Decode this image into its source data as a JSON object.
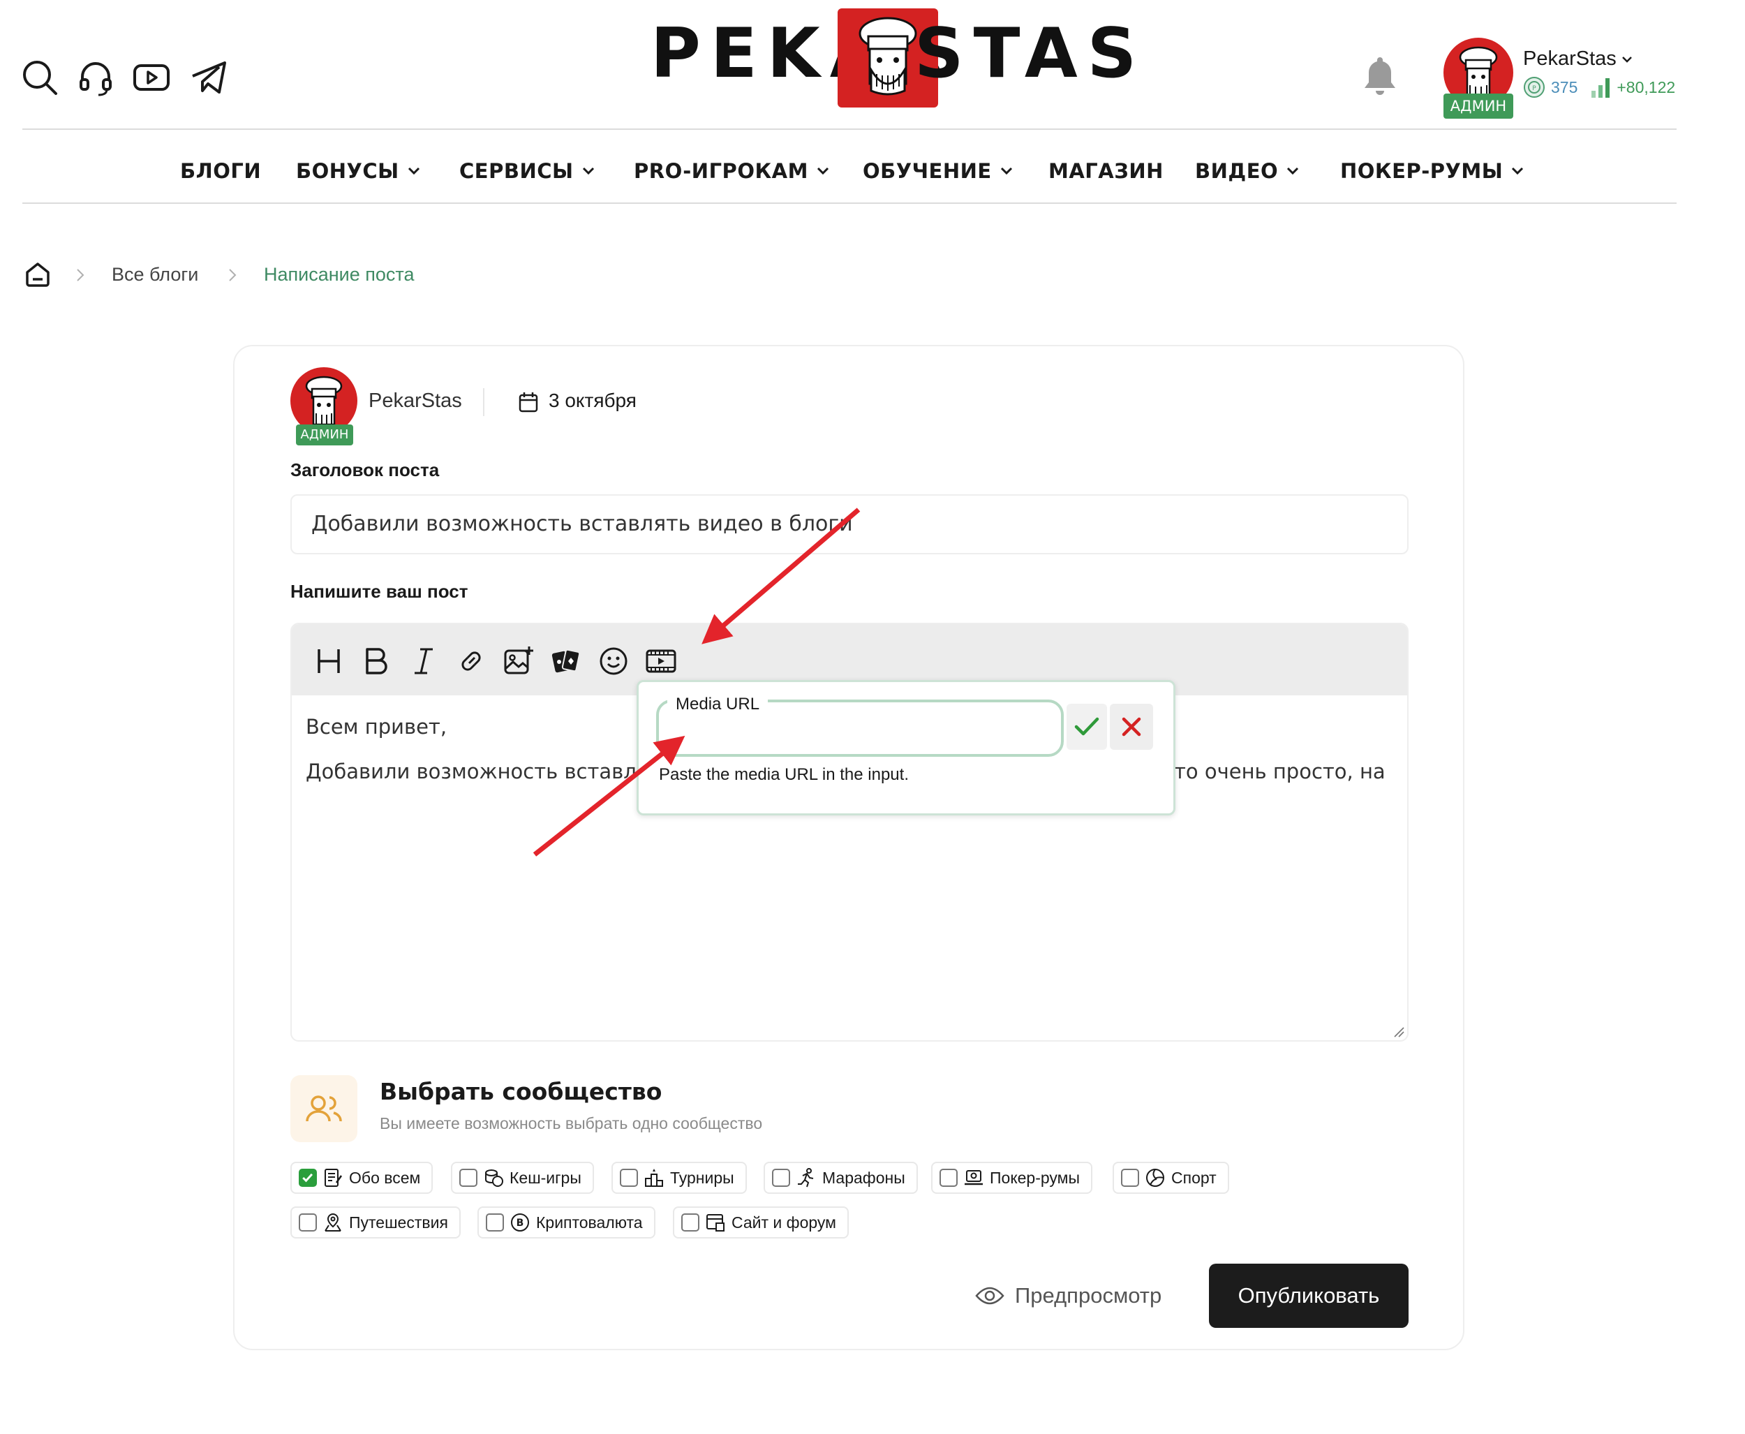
{
  "header": {
    "logo_left": "PEKAR",
    "logo_right": "STAS",
    "icons": [
      "search-icon",
      "headset-icon",
      "youtube-icon",
      "telegram-icon"
    ],
    "user": {
      "name": "PekarStas",
      "role_badge": "АДМИН",
      "points": "375",
      "rating": "+80,122"
    }
  },
  "nav": {
    "items": [
      {
        "label": "БЛОГИ",
        "dropdown": false
      },
      {
        "label": "БОНУСЫ",
        "dropdown": true
      },
      {
        "label": "СЕРВИСЫ",
        "dropdown": true
      },
      {
        "label": "PRO-ИГРОКАМ",
        "dropdown": true
      },
      {
        "label": "ОБУЧЕНИЕ",
        "dropdown": true
      },
      {
        "label": "МАГАЗИН",
        "dropdown": false
      },
      {
        "label": "ВИДЕО",
        "dropdown": true
      },
      {
        "label": "ПОКЕР-РУМЫ",
        "dropdown": true
      }
    ]
  },
  "breadcrumb": {
    "items": [
      "Все блоги",
      "Написание поста"
    ]
  },
  "post": {
    "author": "PekarStas",
    "author_badge": "АДМИН",
    "date": "3 октября",
    "title_label": "Заголовок поста",
    "title_value": "Добавили возможность вставлять видео в блоги",
    "body_label": "Напишите ваш пост",
    "toolbar": [
      "heading-icon",
      "bold-icon",
      "italic-icon",
      "link-icon",
      "image-icon",
      "cards-icon",
      "emoji-icon",
      "video-icon"
    ],
    "body_line1": "Всем привет,",
    "body_line2_start": "Добавили возможность вставля",
    "body_line2_end": "то очень просто, на"
  },
  "media_popup": {
    "legend": "Media URL",
    "value": "",
    "hint": "Paste the media URL in the input."
  },
  "community": {
    "title": "Выбрать сообщество",
    "subtitle": "Вы имеете возможность выбрать одно сообщество",
    "options": [
      {
        "label": "Обо всем",
        "checked": true,
        "icon": "notes-icon"
      },
      {
        "label": "Кеш-игры",
        "checked": false,
        "icon": "coins-icon"
      },
      {
        "label": "Турниры",
        "checked": false,
        "icon": "podium-icon"
      },
      {
        "label": "Марафоны",
        "checked": false,
        "icon": "runner-icon"
      },
      {
        "label": "Покер-румы",
        "checked": false,
        "icon": "laptop-icon"
      },
      {
        "label": "Спорт",
        "checked": false,
        "icon": "volleyball-icon"
      },
      {
        "label": "Путешествия",
        "checked": false,
        "icon": "map-pin-icon"
      },
      {
        "label": "Криптовалюта",
        "checked": false,
        "icon": "bitcoin-icon"
      },
      {
        "label": "Сайт и форум",
        "checked": false,
        "icon": "browser-icon"
      }
    ]
  },
  "actions": {
    "preview": "Предпросмотр",
    "publish": "Опубликовать"
  },
  "colors": {
    "brand_red": "#d42222",
    "admin_green": "#3f9a58",
    "breadcrumb_active": "#3f8a63",
    "annotation_arrow": "#e3242b"
  }
}
